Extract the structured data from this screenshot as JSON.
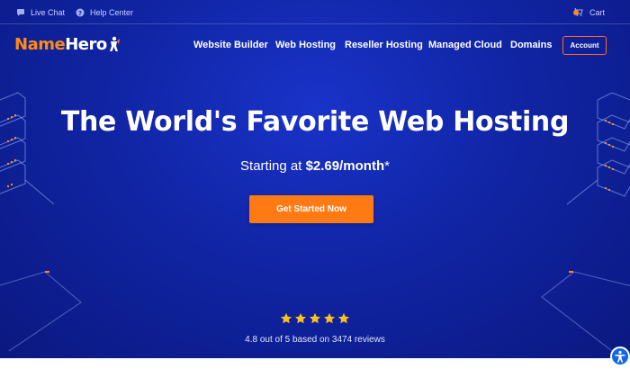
{
  "utility": {
    "live_chat": "Live Chat",
    "help_center": "Help Center",
    "cart": "Cart",
    "cart_icon": "cart-icon",
    "chat_icon": "chat-bubble-icon",
    "help_icon": "question-circle-icon"
  },
  "brand": {
    "name_part1": "Name",
    "name_part2": "Hero",
    "accent": "#ff8a14",
    "mascot_icon": "hero-figure-icon"
  },
  "nav": {
    "items": [
      "Website Builder",
      "Web Hosting",
      "Reseller Hosting",
      "Managed Cloud",
      "Domains"
    ],
    "account": "Account"
  },
  "hero": {
    "headline": "The World's Favorite Web Hosting",
    "starting_prefix": "Starting at ",
    "price": "$2.69/month",
    "price_suffix": "*",
    "cta": "Get Started Now",
    "rating_stars": 5,
    "reviews": "4.8 out of 5 based on 3474 reviews"
  },
  "colors": {
    "hero_bg": "#1126a8",
    "cta_bg": "#ff7a12",
    "star": "#ffc21a"
  },
  "accessibility_icon": "accessibility-icon"
}
